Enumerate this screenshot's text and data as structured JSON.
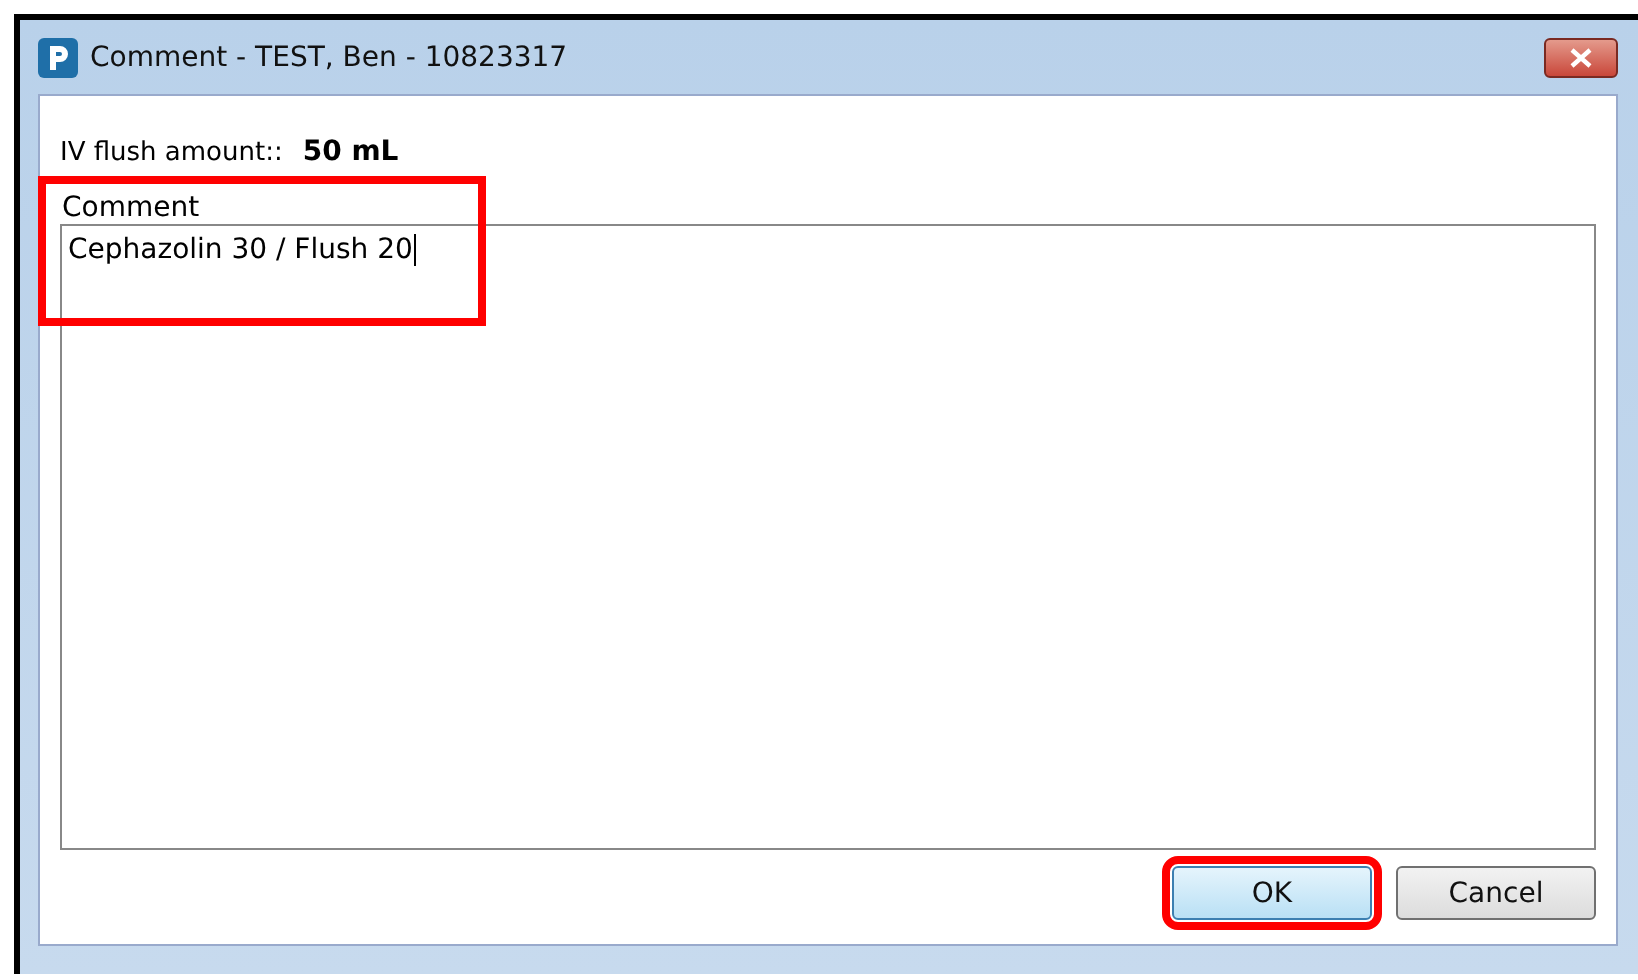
{
  "window": {
    "title": "Comment - TEST, Ben - 10823317"
  },
  "fields": [
    {
      "label": "IV flush amount::",
      "value": "50 mL"
    }
  ],
  "comment": {
    "label": "Comment",
    "value": "Cephazolin 30 / Flush 20",
    "highlighted": true
  },
  "buttons": [
    {
      "label": "OK",
      "default": true,
      "highlighted": true
    },
    {
      "label": "Cancel",
      "default": false,
      "highlighted": false
    }
  ]
}
